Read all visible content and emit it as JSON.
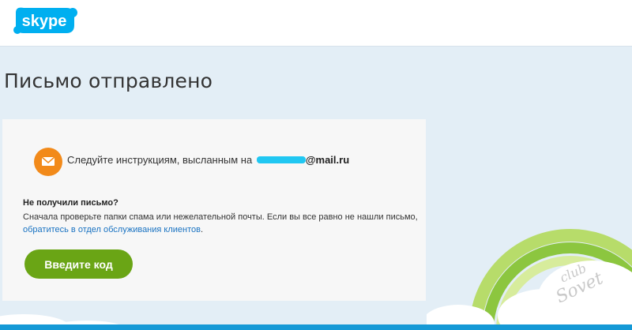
{
  "header": {
    "logo_text": "skype"
  },
  "main": {
    "title": "Письмо отправлено",
    "instruction_prefix": "Следуйте инструкциям, высланным на",
    "email_domain": "@mail.ru",
    "question_title": "Не получили письмо?",
    "question_text": "Сначала проверьте папки спама или нежелательной почты. Если вы все равно не нашли письмо, ",
    "support_link": "обратитесь в отдел обслуживания клиентов",
    "question_end": ".",
    "enter_code_button": "Введите код"
  },
  "watermark": {
    "line1": "club",
    "line2": "Sovet"
  },
  "colors": {
    "skype_blue": "#00aff0",
    "accent_orange": "#f28a1a",
    "button_green": "#6aa515",
    "link_blue": "#1a73c2",
    "redaction": "#20c7f2"
  },
  "icons": {
    "mail": "envelope-icon"
  }
}
